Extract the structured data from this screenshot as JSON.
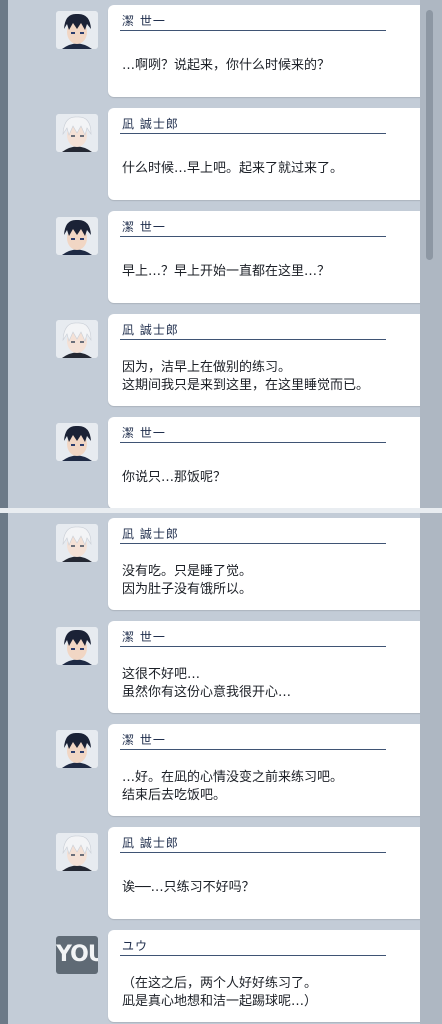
{
  "colors": {
    "panel": "#c3ccd7",
    "bubble": "#ffffff",
    "name_line": "#3f5474",
    "text": "#1b1f26"
  },
  "top_messages": [
    {
      "speaker": "潔 世一",
      "avatar": "isagi",
      "text": "…啊咧？说起来，你什么时候来的？"
    },
    {
      "speaker": "凪 誠士郎",
      "avatar": "nagi",
      "text": "什么时候…早上吧。起来了就过来了。"
    },
    {
      "speaker": "潔 世一",
      "avatar": "isagi",
      "text": "早上…？早上开始一直都在这里…？"
    },
    {
      "speaker": "凪 誠士郎",
      "avatar": "nagi",
      "text": "因为，洁早上在做别的练习。\n这期间我只是来到这里，在这里睡觉而已。"
    },
    {
      "speaker": "潔 世一",
      "avatar": "isagi",
      "text": "你说只…那饭呢？"
    }
  ],
  "bottom_messages": [
    {
      "speaker": "凪 誠士郎",
      "avatar": "nagi",
      "text": "没有吃。只是睡了觉。\n因为肚子没有饿所以。"
    },
    {
      "speaker": "潔 世一",
      "avatar": "isagi",
      "text": "这很不好吧…\n虽然你有这份心意我很开心…"
    },
    {
      "speaker": "潔 世一",
      "avatar": "isagi",
      "text": "…好。在凪的心情没变之前来练习吧。\n结束后去吃饭吧。"
    },
    {
      "speaker": "凪 誠士郎",
      "avatar": "nagi",
      "text": "诶──…只练习不好吗？"
    },
    {
      "speaker": "ユウ",
      "avatar": "you",
      "avatar_label": "YOU",
      "text": "（在这之后，两个人好好练习了。\n凪是真心地想和洁一起踢球呢…）"
    }
  ]
}
